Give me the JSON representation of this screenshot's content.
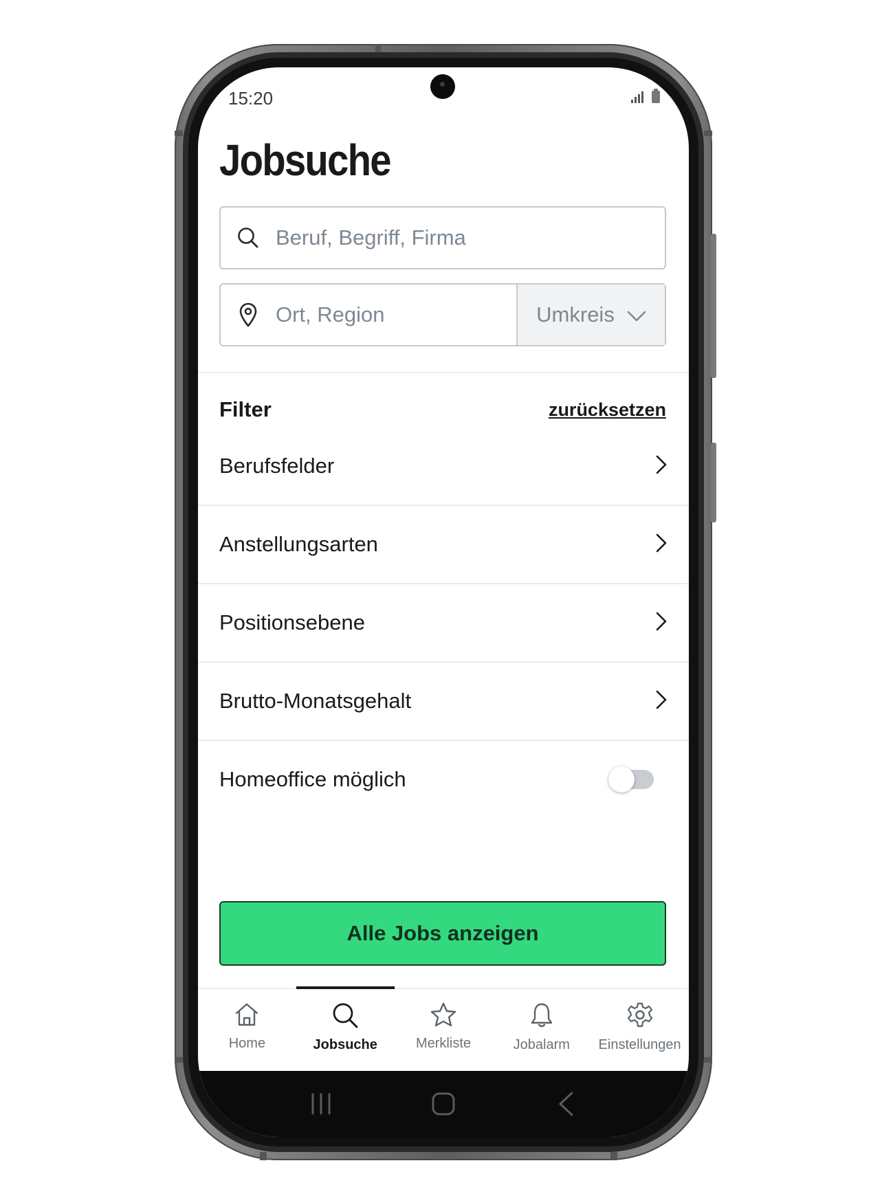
{
  "status_bar": {
    "time": "15:20"
  },
  "header": {
    "title": "Jobsuche"
  },
  "search": {
    "job_placeholder": "Beruf, Begriff, Firma",
    "location_placeholder": "Ort, Region",
    "radius_label": "Umkreis"
  },
  "filter": {
    "title": "Filter",
    "reset_label": "zurücksetzen",
    "items": [
      {
        "label": "Berufsfelder"
      },
      {
        "label": "Anstellungsarten"
      },
      {
        "label": "Positionsebene"
      },
      {
        "label": "Brutto-Monatsgehalt"
      }
    ],
    "homeoffice": {
      "label": "Homeoffice möglich",
      "enabled": false
    }
  },
  "cta": {
    "label": "Alle Jobs anzeigen"
  },
  "tabbar": {
    "active": "Jobsuche",
    "tabs": [
      {
        "label": "Home",
        "icon": "home-icon"
      },
      {
        "label": "Jobsuche",
        "icon": "search-icon"
      },
      {
        "label": "Merkliste",
        "icon": "star-icon"
      },
      {
        "label": "Jobalarm",
        "icon": "bell-icon"
      },
      {
        "label": "Einstellungen",
        "icon": "gear-icon"
      }
    ]
  },
  "colors": {
    "accent_green": "#34d97f",
    "text_primary": "#1a1a1a",
    "placeholder": "#7d8893"
  }
}
